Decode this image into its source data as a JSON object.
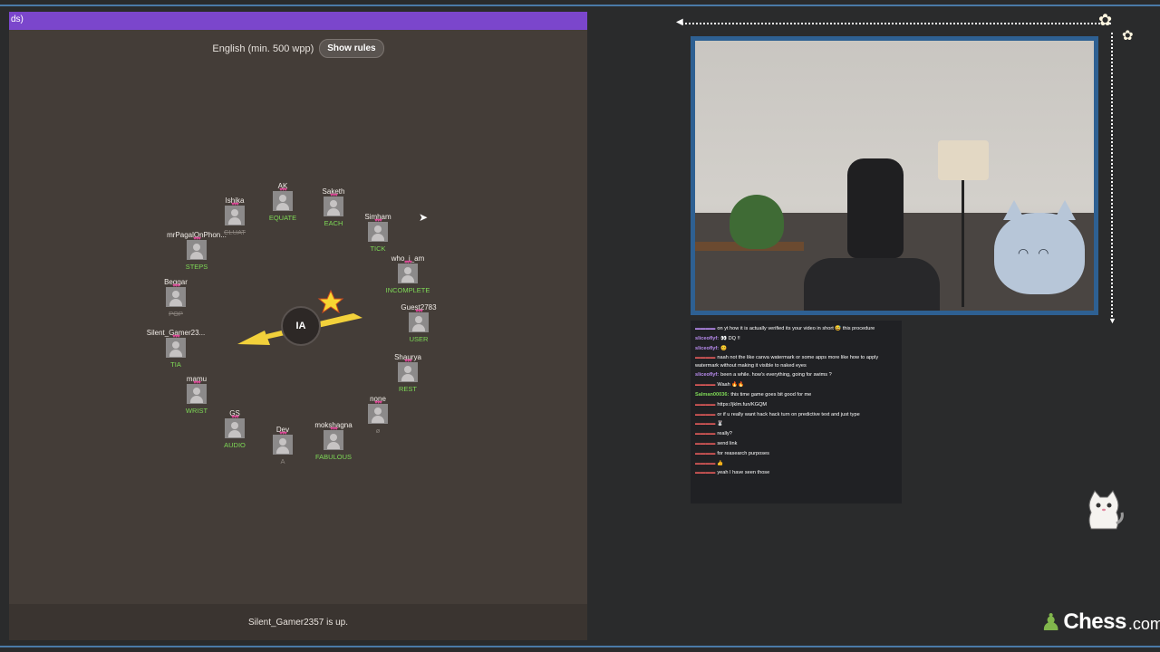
{
  "game": {
    "topbar_text": "ds)",
    "language_label": "English (min. 500 wpp)",
    "show_rules_label": "Show rules",
    "status_text": "Silent_Gamer2357 is up.",
    "center_label": "IA",
    "players": [
      {
        "name": "AK",
        "word": "EQUATE",
        "style": "green"
      },
      {
        "name": "Saketh",
        "word": "EACH",
        "style": "green"
      },
      {
        "name": "Ishika",
        "word": "CLUAT",
        "style": "gray"
      },
      {
        "name": "Simham",
        "word": "TICK",
        "style": "green"
      },
      {
        "name": "mrPagalOnPhon...",
        "word": "STEPS",
        "style": "green"
      },
      {
        "name": "who_i_am",
        "word": "INCOMPLETE",
        "style": "green"
      },
      {
        "name": "Beggar",
        "word": "POP",
        "style": "gray"
      },
      {
        "name": "Guest2783",
        "word": "USER",
        "style": "green"
      },
      {
        "name": "Silent_Gamer23...",
        "word": "TIA",
        "style": "green"
      },
      {
        "name": "Shaurya",
        "word": "REST",
        "style": "green"
      },
      {
        "name": "mamu",
        "word": "WRIST",
        "style": "green"
      },
      {
        "name": "none",
        "word": "ø",
        "style": "dim"
      },
      {
        "name": "GS",
        "word": "AUDIO",
        "style": "green"
      },
      {
        "name": "mokshagna",
        "word": "FABULOUS",
        "style": "green"
      },
      {
        "name": "Dev",
        "word": "A",
        "style": "dim"
      }
    ]
  },
  "chat": {
    "messages": [
      {
        "user": "",
        "user_color": "#b98cf0",
        "text": "on yt how it is actually verified its your video in short 😅 this procedure"
      },
      {
        "user": "sliceoflyf:",
        "user_color": "#b98cf0",
        "text": "👀 DQ !!"
      },
      {
        "user": "sliceoflyf:",
        "user_color": "#b98cf0",
        "text": "😊"
      },
      {
        "user": "",
        "user_color": "#e05a5a",
        "text": "naah not the like canva watermark or some apps more like how to apply watermark without making it visible to naked eyes"
      },
      {
        "user": "sliceoflyf:",
        "user_color": "#b98cf0",
        "text": "been a while. how's everything, going for swims ?"
      },
      {
        "user": "",
        "user_color": "#e05a5a",
        "text": "Waah 🔥🔥"
      },
      {
        "user": "Salman00036:",
        "user_color": "#7ed956",
        "text": "this time game goes bit good for me"
      },
      {
        "user": "",
        "user_color": "#e05a5a",
        "text": "https://jklm.fun/KGQM"
      },
      {
        "user": "",
        "user_color": "#e05a5a",
        "text": "or if u really want hack hack turn on predictive text and just type"
      },
      {
        "user": "",
        "user_color": "#e05a5a",
        "text": "🐰"
      },
      {
        "user": "",
        "user_color": "#e05a5a",
        "text": "really?"
      },
      {
        "user": "",
        "user_color": "#e05a5a",
        "text": "send link"
      },
      {
        "user": "",
        "user_color": "#e05a5a",
        "text": "for reasearch purposes"
      },
      {
        "user": "",
        "user_color": "#e05a5a",
        "text": "👍"
      },
      {
        "user": "",
        "user_color": "#e05a5a",
        "text": "yeah I have seen those"
      }
    ]
  },
  "branding": {
    "logo_word": "Chess",
    "logo_suffix": ".com",
    "logo_color": "#81b64c"
  },
  "colors": {
    "accent": "#7b46cc",
    "webcam_frame": "#2e6092",
    "valid_word": "#7ed956"
  }
}
